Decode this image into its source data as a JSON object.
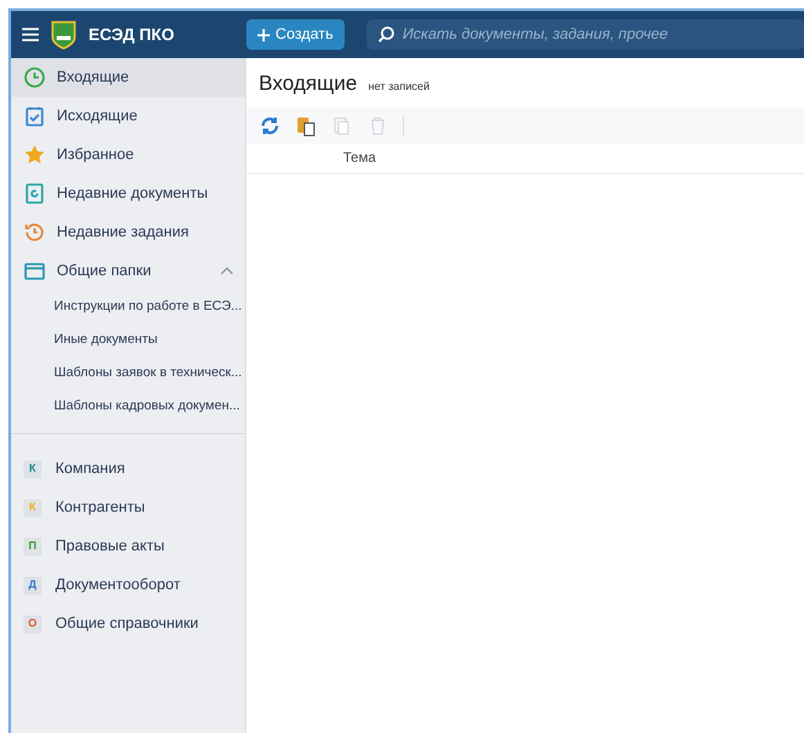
{
  "header": {
    "logo_text": "ЕСЭД ПКО",
    "create_button": "Создать",
    "search": {
      "placeholder": "Искать документы, задания, прочее"
    }
  },
  "sidebar": {
    "items": [
      {
        "kind": "clock",
        "label": "Входящие",
        "selected": true
      },
      {
        "kind": "checklist",
        "label": "Исходящие",
        "selected": false
      },
      {
        "kind": "star",
        "label": "Избранное",
        "selected": false
      },
      {
        "kind": "document",
        "label": "Недавние документы",
        "selected": false
      },
      {
        "kind": "history",
        "label": "Недавние задания",
        "selected": false
      },
      {
        "kind": "folder",
        "label": "Общие папки",
        "selected": false,
        "expanded": true,
        "children": [
          {
            "label": "Инструкции по работе в ЕСЭ..."
          },
          {
            "label": "Иные документы"
          },
          {
            "label": "Шаблоны заявок в техническ..."
          },
          {
            "label": "Шаблоны кадровых докумен..."
          }
        ]
      }
    ],
    "directories": [
      {
        "letter": "К",
        "label": "Компания",
        "color": "#1e8a8a"
      },
      {
        "letter": "К",
        "label": "Контрагенты",
        "color": "#f0b020"
      },
      {
        "letter": "П",
        "label": "Правовые акты",
        "color": "#3a9a3a"
      },
      {
        "letter": "Д",
        "label": "Документооборот",
        "color": "#3a78c0"
      },
      {
        "letter": "О",
        "label": "Общие справочники",
        "color": "#e05a3a"
      }
    ]
  },
  "main": {
    "title": "Входящие",
    "count": "нет записей",
    "toolbar": [
      {
        "kind": "refresh",
        "disabled": false
      },
      {
        "kind": "paste",
        "disabled": false
      },
      {
        "kind": "copy",
        "disabled": true
      },
      {
        "kind": "delete",
        "disabled": true
      }
    ],
    "table": {
      "columns": [
        "Тема"
      ]
    }
  }
}
